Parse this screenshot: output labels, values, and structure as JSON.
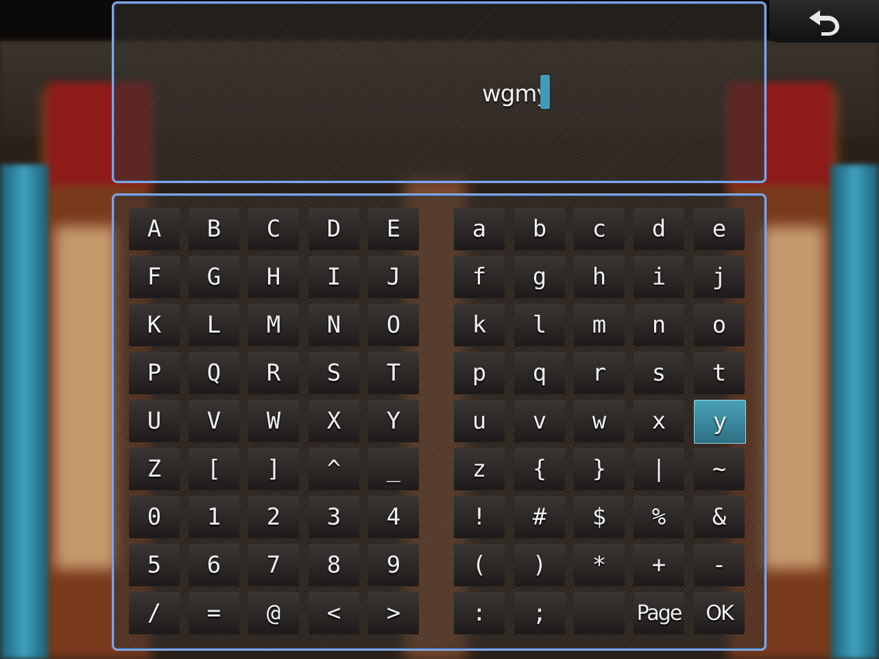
{
  "input": {
    "value": "wgmy"
  },
  "back_icon": "back-arrow-icon",
  "keyboard": {
    "selected": "y",
    "rows": [
      [
        "A",
        "B",
        "C",
        "D",
        "E",
        "a",
        "b",
        "c",
        "d",
        "e"
      ],
      [
        "F",
        "G",
        "H",
        "I",
        "J",
        "f",
        "g",
        "h",
        "i",
        "j"
      ],
      [
        "K",
        "L",
        "M",
        "N",
        "O",
        "k",
        "l",
        "m",
        "n",
        "o"
      ],
      [
        "P",
        "Q",
        "R",
        "S",
        "T",
        "p",
        "q",
        "r",
        "s",
        "t"
      ],
      [
        "U",
        "V",
        "W",
        "X",
        "Y",
        "u",
        "v",
        "w",
        "x",
        "y"
      ],
      [
        "Z",
        "[",
        "]",
        "^",
        "_",
        "z",
        "{",
        "}",
        "|",
        "~"
      ],
      [
        "0",
        "1",
        "2",
        "3",
        "4",
        "!",
        "#",
        "$",
        "%",
        "&"
      ],
      [
        "5",
        "6",
        "7",
        "8",
        "9",
        "(",
        ")",
        "*",
        "+",
        "-"
      ],
      [
        "/",
        "=",
        "@",
        "<",
        ">",
        ":",
        ";",
        "",
        "Page",
        "OK"
      ]
    ]
  },
  "colors": {
    "border": "#7fa6e6",
    "selected": "#3f9bb8",
    "cursor": "#3f9bb8"
  }
}
